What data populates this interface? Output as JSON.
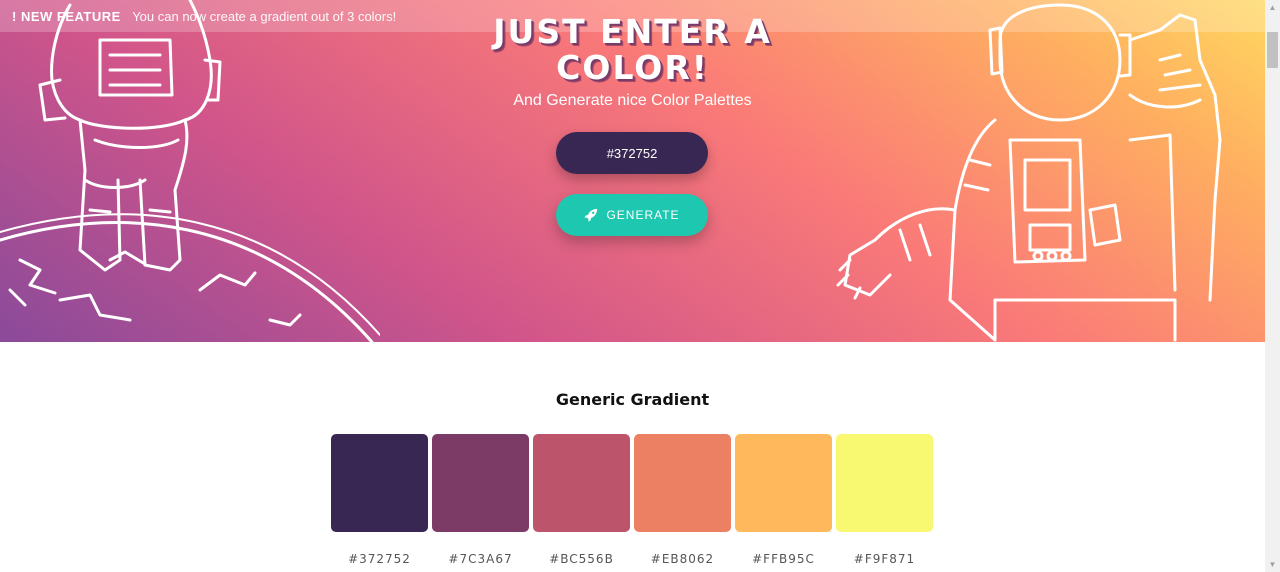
{
  "banner": {
    "tag": "! NEW FEATURE",
    "message": "You can now create a gradient out of 3 colors!"
  },
  "hero": {
    "title": "JUST ENTER A COLOR!",
    "subtitle": "And Generate nice Color Palettes",
    "color_input_value": "#372752",
    "generate_label": "GENERATE",
    "generate_icon": "rocket-icon"
  },
  "palette_section": {
    "title": "Generic Gradient",
    "swatches": [
      {
        "hex": "#372752"
      },
      {
        "hex": "#7C3A67"
      },
      {
        "hex": "#BC556B"
      },
      {
        "hex": "#EB8062"
      },
      {
        "hex": "#FFB95C"
      },
      {
        "hex": "#F9F871"
      }
    ]
  },
  "colors": {
    "input_bg": "#372752",
    "generate_bg": "#1EC8B0"
  }
}
